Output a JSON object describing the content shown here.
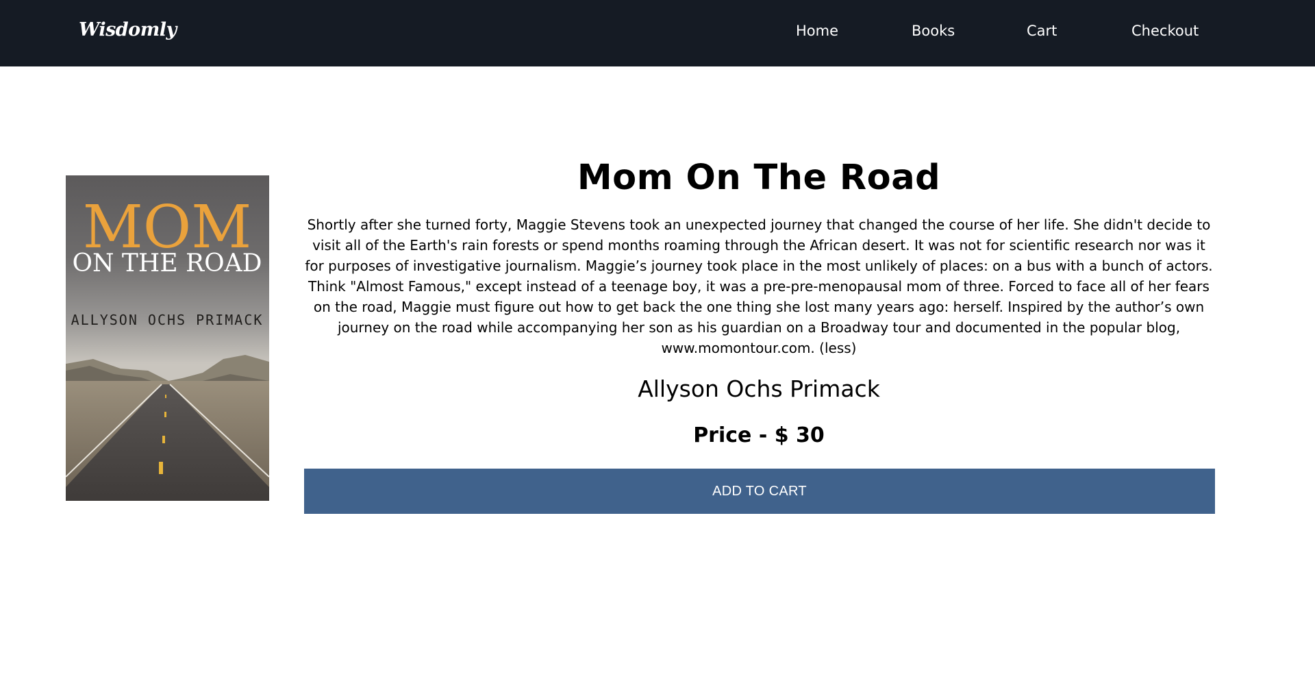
{
  "header": {
    "logo": "Wisdomly",
    "nav": [
      "Home",
      "Books",
      "Cart",
      "Checkout"
    ]
  },
  "book": {
    "title": "Mom On The Road",
    "description": "Shortly after she turned forty, Maggie Stevens took an unexpected journey that changed the course of her life. She didn't decide to visit all of the Earth's rain forests or spend months roaming through the African desert. It was not for scientific research nor was it for purposes of investigative journalism. Maggie’s journey took place in the most unlikely of places: on a bus with a bunch of actors. Think \"Almost Famous,\" except instead of a teenage boy, it was a pre-pre-menopausal mom of three. Forced to face all of her fears on the road, Maggie must figure out how to get back the one thing she lost many years ago: herself. Inspired by the author’s own journey on the road while accompanying her son as his guardian on a Broadway tour and documented in the popular blog, www.momontour.com. (less)",
    "author": "Allyson Ochs Primack",
    "price_label": "Price - $ 30",
    "cover": {
      "title_line1": "MOM",
      "title_line2": "ON THE ROAD",
      "author": "ALLYSON OCHS PRIMACK"
    }
  },
  "actions": {
    "add_to_cart": "ADD TO CART"
  },
  "colors": {
    "navbar_bg": "#151b24",
    "button_bg": "#40628c",
    "cover_title_orange": "#eaa23c"
  }
}
